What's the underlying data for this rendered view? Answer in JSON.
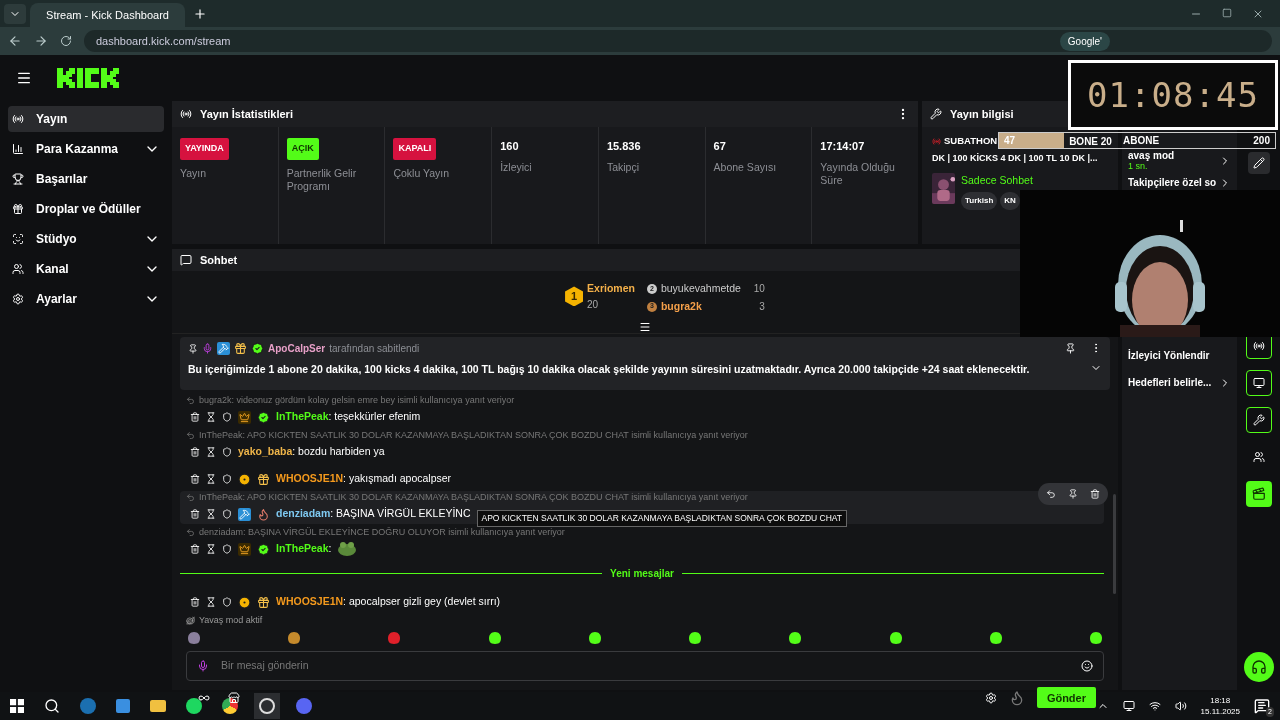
{
  "browser": {
    "tab_title": "Stream - Kick Dashboard",
    "url": "dashboard.kick.com/stream",
    "lens_chip": "Google'"
  },
  "sidebar": {
    "items": [
      {
        "label": "Yayın",
        "selected": true,
        "expandable": false
      },
      {
        "label": "Para Kazanma",
        "selected": false,
        "expandable": true
      },
      {
        "label": "Başarılar",
        "selected": false,
        "expandable": false
      },
      {
        "label": "Droplar ve Ödüller",
        "selected": false,
        "expandable": false
      },
      {
        "label": "Stüdyo",
        "selected": false,
        "expandable": true
      },
      {
        "label": "Kanal",
        "selected": false,
        "expandable": true
      },
      {
        "label": "Ayarlar",
        "selected": false,
        "expandable": true
      }
    ]
  },
  "stats": {
    "title": "Yayın İstatistikleri",
    "items": [
      {
        "kind": "status",
        "value": "YAYINDA",
        "color": "#d6123f",
        "label": "Yayın"
      },
      {
        "kind": "status",
        "value": "AÇIK",
        "color": "#53fc18",
        "label": "Partnerlik Gelir Programı"
      },
      {
        "kind": "status",
        "value": "KAPALI",
        "color": "#d6123f",
        "label": "Çoklu Yayın"
      },
      {
        "kind": "number",
        "value": "160",
        "label": "İzleyici"
      },
      {
        "kind": "number",
        "value": "15.836",
        "label": "Takipçi"
      },
      {
        "kind": "number",
        "value": "67",
        "label": "Abone Sayısı"
      },
      {
        "kind": "number",
        "value": "17:14:07",
        "label": "Yayında Olduğu Süre"
      }
    ]
  },
  "stream_info": {
    "title": "Yayın bilgisi",
    "title_start": "SUBATHON",
    "title_rest": "BONE 20",
    "title_line2": "DK | 100 KİCKS 4 DK | 100 TL 10 DK |...",
    "category": "Sadece Sohbet",
    "tags": [
      "Turkish",
      "KN"
    ]
  },
  "chat_settings": {
    "slow_mode": "avaş mod",
    "slow_value": "1 sn.",
    "followers_only": "Takipçilere özel so",
    "redirect": "İzleyici Yönlendir",
    "goals": "Hedefleri belirle..."
  },
  "chat": {
    "title": "Sohbet",
    "leaderboard": [
      {
        "rank": "1",
        "name": "Exriomen",
        "count": "20"
      },
      {
        "rank": "2",
        "name": "buyukevahmetde",
        "count": "10"
      },
      {
        "rank": "3",
        "name": "bugra2k",
        "count": "3"
      }
    ],
    "pinned": {
      "user": "ApoCalpSer",
      "by": "tarafından sabitlendi",
      "text": "Bu içeriğimizde 1 abone 20 dakika, 100 kicks 4 dakika, 100 TL bağış 10 dakika olacak şekilde yayının süresini uzatmaktadır. Ayrıca 20.000 takipçide +24 saat eklenecektir."
    },
    "messages": [
      {
        "kind": "message",
        "reply": "bugra2k: videonuz gördüm kolay gelsin emre bey isimli kullanıcıya yanıt veriyor",
        "badges": [
          {
            "kind": "crown"
          },
          {
            "kind": "verified"
          }
        ],
        "user": "InThePeak",
        "color": "#53fc18",
        "text": ": teşekkürler efenim",
        "hovered": false
      },
      {
        "kind": "message",
        "reply": "InThePeak: APO KICKTEN SAATLIK 30 DOLAR KAZANMAYA BAŞLADIKTAN SONRA ÇOK BOZDU CHAT isimli kullanıcıya yanıt veriyor",
        "user": "yako_baba",
        "color": "#f0b64a",
        "text": ": bozdu harbiden ya",
        "hovered": false
      },
      {
        "kind": "message",
        "badges": [
          {
            "kind": "one"
          },
          {
            "kind": "gift"
          }
        ],
        "user": "WHOOSJE1N",
        "color": "#f59a1d",
        "text": ": yakışmadı apocalpser",
        "hovered": false
      },
      {
        "kind": "message",
        "reply": "InThePeak: APO KICKTEN SAATLIK 30 DOLAR KAZANMAYA BAŞLADIKTAN SONRA ÇOK BOZDU CHAT isimli kullanıcıya yanıt veriyor",
        "badges": [
          {
            "kind": "hammer"
          },
          {
            "kind": "og"
          }
        ],
        "user": "denziadam",
        "color": "#7ec8f0",
        "text": ": BAŞINA VİRGÜL EKLEYİNC",
        "hovered": true,
        "tooltip": "APO KICKTEN SAATLIK 30 DOLAR KAZANMAYA BAŞLADIKTAN SONRA ÇOK BOZDU CHAT"
      },
      {
        "kind": "message",
        "reply": "denziadam: BAŞINA VİRGÜL EKLEYİNCE DOĞRU OLUYOR isimli kullanıcıya yanıt veriyor",
        "badges": [
          {
            "kind": "crown"
          },
          {
            "kind": "verified"
          }
        ],
        "user": "InThePeak",
        "color": "#53fc18",
        "text": ":",
        "emote": true,
        "hovered": false
      },
      {
        "kind": "divider",
        "text": "Yeni mesajlar"
      },
      {
        "kind": "message",
        "badges": [
          {
            "kind": "one"
          },
          {
            "kind": "gift"
          }
        ],
        "user": "WHOOSJE1N",
        "color": "#f59a1d",
        "text": ": apocalpser gizli gey (devlet sırrı)",
        "hovered": false
      }
    ],
    "slow_mode_notice": "Yavaş mod aktif",
    "emotes": [
      {
        "color": "#8a7f9c"
      },
      {
        "color": "#c58a2c"
      },
      {
        "color": "#e0202a"
      },
      {
        "color": "#53fc18"
      },
      {
        "color": "#53fc18"
      },
      {
        "color": "#53fc18"
      },
      {
        "color": "#53fc18"
      },
      {
        "color": "#53fc18"
      },
      {
        "color": "#53fc18"
      },
      {
        "color": "#53fc18"
      }
    ],
    "input_placeholder": "Bir mesaj gönderin",
    "send": "Gönder"
  },
  "overlay": {
    "timer": "01:08:45",
    "sub_goal": {
      "current": "47",
      "label": "ABONE",
      "target": "200",
      "level": 0.235
    }
  },
  "taskbar": {
    "time": "18:18",
    "date": "15.11.2025",
    "notifications": "2"
  }
}
